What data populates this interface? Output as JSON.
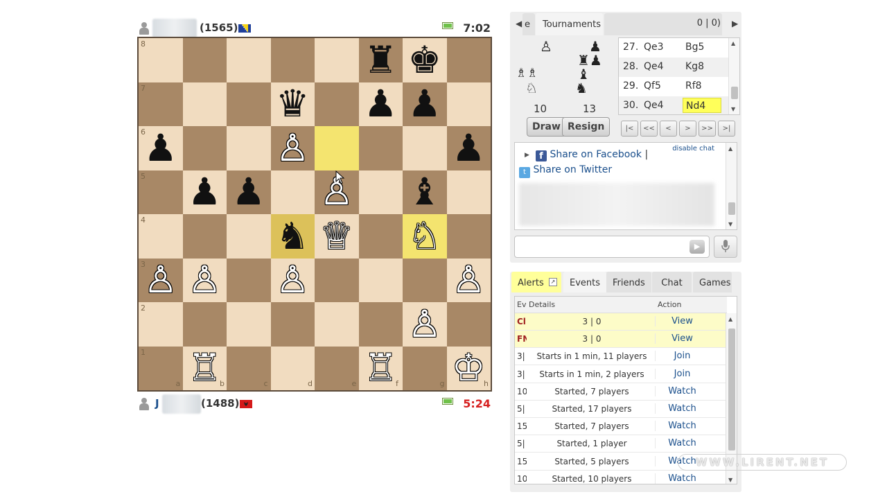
{
  "top_player": {
    "rating": "(1565)",
    "clock": "7:02",
    "flag_colors": [
      "#1f3f9a",
      "#f5d313"
    ]
  },
  "bottom_player": {
    "name_initial": "J",
    "rating": "(1488)",
    "clock": "5:24",
    "clock_color": "#d62020",
    "flag_colors": [
      "#d41a1a",
      "#222222"
    ]
  },
  "board": {
    "rank_labels": [
      "8",
      "7",
      "6",
      "5",
      "4",
      "3",
      "2",
      "1"
    ],
    "file_labels": [
      "a",
      "b",
      "c",
      "d",
      "e",
      "f",
      "g",
      "h"
    ],
    "light_color": "#f1dcc0",
    "dark_color": "#a88866",
    "highlight_squares": [
      "e6",
      "g4"
    ],
    "dark_highlight_squares": [
      "d4"
    ],
    "pieces": [
      {
        "sq": "f8",
        "type": "rook",
        "color": "b"
      },
      {
        "sq": "g8",
        "type": "king",
        "color": "b"
      },
      {
        "sq": "d7",
        "type": "queen",
        "color": "b"
      },
      {
        "sq": "f7",
        "type": "pawn",
        "color": "b"
      },
      {
        "sq": "g7",
        "type": "pawn",
        "color": "b"
      },
      {
        "sq": "a6",
        "type": "pawn",
        "color": "b"
      },
      {
        "sq": "d6",
        "type": "pawn",
        "color": "w"
      },
      {
        "sq": "h6",
        "type": "pawn",
        "color": "b"
      },
      {
        "sq": "b5",
        "type": "pawn",
        "color": "b"
      },
      {
        "sq": "c5",
        "type": "pawn",
        "color": "b"
      },
      {
        "sq": "e5",
        "type": "pawn",
        "color": "w"
      },
      {
        "sq": "g5",
        "type": "bishop",
        "color": "b"
      },
      {
        "sq": "d4",
        "type": "knight",
        "color": "b"
      },
      {
        "sq": "e4",
        "type": "queen",
        "color": "w"
      },
      {
        "sq": "g4",
        "type": "knight",
        "color": "w"
      },
      {
        "sq": "a3",
        "type": "pawn",
        "color": "w"
      },
      {
        "sq": "b3",
        "type": "pawn",
        "color": "w"
      },
      {
        "sq": "d3",
        "type": "pawn",
        "color": "w"
      },
      {
        "sq": "h3",
        "type": "pawn",
        "color": "w"
      },
      {
        "sq": "g2",
        "type": "pawn",
        "color": "w"
      },
      {
        "sq": "b1",
        "type": "rook",
        "color": "w"
      },
      {
        "sq": "f1",
        "type": "rook",
        "color": "w"
      },
      {
        "sq": "h1",
        "type": "king",
        "color": "w"
      }
    ]
  },
  "game_panel": {
    "tab_partial": "e",
    "tab_tournaments": "Tournaments",
    "score": "0 | 0)",
    "captured_left_count": "10",
    "captured_right_count": "13",
    "captured_left_icons": [
      "white-pawn-icon",
      "white-bishop-icon",
      "white-bishop-icon",
      "white-knight-icon"
    ],
    "captured_right_icons": [
      "black-pawn-icon",
      "black-pawn-icon",
      "black-rook-icon",
      "black-bishop-icon",
      "black-knight-icon"
    ],
    "draw_label": "Draw",
    "resign_label": "Resign",
    "moves": [
      {
        "num": "27.",
        "white": "Qe3",
        "black": "Bg5"
      },
      {
        "num": "28.",
        "white": "Qe4",
        "black": "Kg8"
      },
      {
        "num": "29.",
        "white": "Qf5",
        "black": "Rf8"
      },
      {
        "num": "30.",
        "white": "Qe4",
        "black": "Nd4"
      }
    ],
    "nav_buttons": [
      "|<",
      "<<",
      "<",
      ">",
      ">>",
      ">|"
    ]
  },
  "chat": {
    "share_facebook": "Share on Facebook",
    "separator": "|",
    "share_twitter": "Share on Twitter",
    "disable_chat": "disable chat",
    "input_placeholder": ""
  },
  "events_panel": {
    "tabs": [
      "Alerts",
      "Events",
      "Friends",
      "Chat",
      "Games"
    ],
    "col_event": "Ev",
    "col_details": "Details",
    "col_action": "Action",
    "rows": [
      {
        "ev": "Cl",
        "details": "3 | 0",
        "action": "View",
        "highlight": true
      },
      {
        "ev": "FN",
        "details": "3 | 0",
        "action": "View",
        "highlight": true
      },
      {
        "ev": "3|",
        "details": "Starts in 1 min, 11 players",
        "action": "Join",
        "highlight": false
      },
      {
        "ev": "3|",
        "details": "Starts in 1 min, 2 players",
        "action": "Join",
        "highlight": false
      },
      {
        "ev": "10",
        "details": "Started, 7 players",
        "action": "Watch",
        "highlight": false
      },
      {
        "ev": "5|",
        "details": "Started, 17 players",
        "action": "Watch",
        "highlight": false
      },
      {
        "ev": "15",
        "details": "Started, 7 players",
        "action": "Watch",
        "highlight": false
      },
      {
        "ev": "5|",
        "details": "Started, 1 player",
        "action": "Watch",
        "highlight": false
      },
      {
        "ev": "15",
        "details": "Started, 5 players",
        "action": "Watch",
        "highlight": false
      },
      {
        "ev": "10",
        "details": "Started, 10 players",
        "action": "Watch",
        "highlight": false
      }
    ]
  },
  "watermark": "WWW.LIRENT.NET"
}
